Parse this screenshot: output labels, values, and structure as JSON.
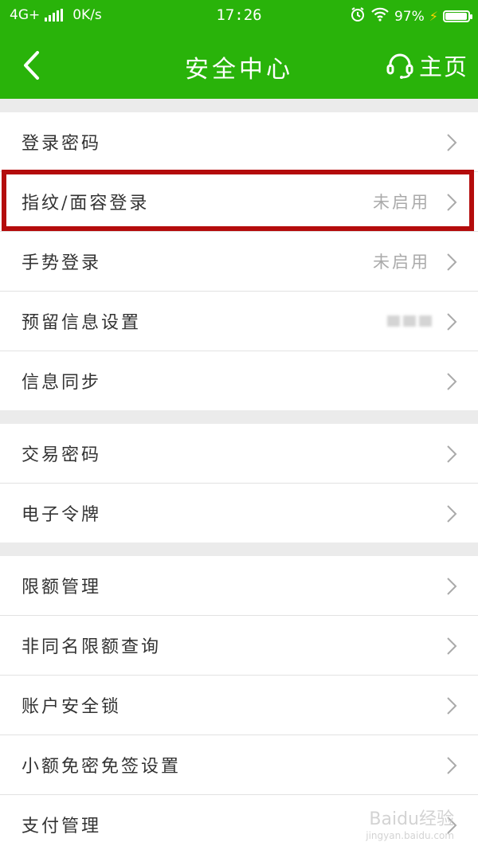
{
  "status_bar": {
    "network": "4G+",
    "speed": "0K/s",
    "time": "17:26",
    "battery": "97%",
    "icons": [
      "signal-icon",
      "alarm-icon",
      "wifi-icon",
      "charging-icon",
      "battery-icon"
    ]
  },
  "header": {
    "title": "安全中心",
    "home_label": "主页",
    "background_color": "#29b30a",
    "icons": [
      "back-arrow-icon",
      "headset-icon"
    ]
  },
  "sections": [
    {
      "rows": [
        {
          "label": "登录密码",
          "value": ""
        },
        {
          "label": "指纹/面容登录",
          "value": "未启用"
        },
        {
          "label": "手势登录",
          "value": "未启用"
        },
        {
          "label": "预留信息设置",
          "value": ""
        },
        {
          "label": "信息同步",
          "value": ""
        }
      ]
    },
    {
      "rows": [
        {
          "label": "交易密码",
          "value": ""
        },
        {
          "label": "电子令牌",
          "value": ""
        }
      ]
    },
    {
      "rows": [
        {
          "label": "限额管理",
          "value": ""
        },
        {
          "label": "非同名限额查询",
          "value": ""
        },
        {
          "label": "账户安全锁",
          "value": ""
        },
        {
          "label": "小额免密免签设置",
          "value": ""
        },
        {
          "label": "支付管理",
          "value": ""
        }
      ]
    }
  ],
  "highlight_color": "#b40c0c",
  "watermark": {
    "text": "Baidu经验",
    "sub": "jingyan.baidu.com"
  }
}
